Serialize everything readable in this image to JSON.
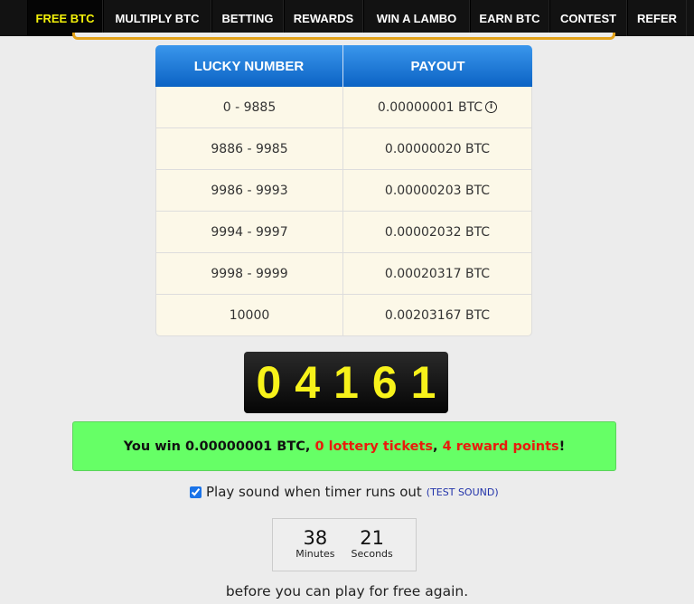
{
  "nav": [
    "FREE BTC",
    "MULTIPLY BTC",
    "BETTING",
    "REWARDS",
    "WIN A LAMBO",
    "EARN BTC",
    "CONTEST",
    "REFER"
  ],
  "table": {
    "headers": [
      "LUCKY NUMBER",
      "PAYOUT"
    ],
    "rows": [
      [
        "0 - 9885",
        "0.00000001 BTC"
      ],
      [
        "9886 - 9985",
        "0.00000020 BTC"
      ],
      [
        "9986 - 9993",
        "0.00000203 BTC"
      ],
      [
        "9994 - 9997",
        "0.00002032 BTC"
      ],
      [
        "9998 - 9999",
        "0.00020317 BTC"
      ],
      [
        "10000",
        "0.00203167 BTC"
      ]
    ],
    "info_icon": "i"
  },
  "roll": [
    "0",
    "4",
    "1",
    "6",
    "1"
  ],
  "win": {
    "prefix": "You win 0.00000001 BTC, ",
    "tickets": "0 lottery tickets",
    "sep": ", ",
    "points": "4 reward points",
    "suffix": "!"
  },
  "sound": {
    "label": "Play sound when timer runs out",
    "checked": true,
    "test": "(TEST SOUND)"
  },
  "timer": {
    "minutes": "38",
    "minutes_label": "Minutes",
    "seconds": "21",
    "seconds_label": "Seconds"
  },
  "again": "before you can play for free again.",
  "colors": {
    "accent": "#f4f20a",
    "win_bg": "#66ff66",
    "red": "#e81c0c",
    "header_blue": "#0b63c4"
  }
}
